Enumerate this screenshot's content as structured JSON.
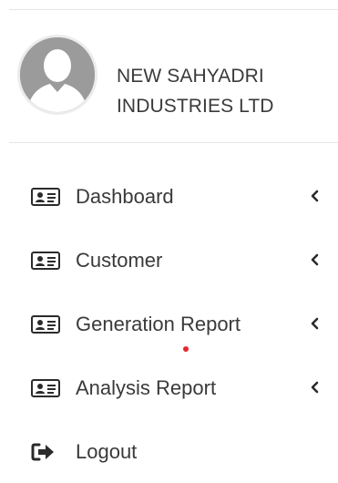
{
  "profile": {
    "name_line1": "NEW SAHYADRI",
    "name_line2": "INDUSTRIES LTD",
    "avatar_icon": "user-silhouette-icon"
  },
  "nav": {
    "items": [
      {
        "label": "Dashboard",
        "icon": "id-card-icon",
        "expandable": true
      },
      {
        "label": "Customer",
        "icon": "id-card-icon",
        "expandable": true
      },
      {
        "label": "Generation Report",
        "icon": "id-card-icon",
        "expandable": true
      },
      {
        "label": "Analysis Report",
        "icon": "id-card-icon",
        "expandable": true
      },
      {
        "label": "Logout",
        "icon": "sign-out-icon",
        "expandable": false
      }
    ]
  },
  "colors": {
    "text": "#3a3a3a",
    "icon": "#2b2b2b",
    "divider": "#e6e6e6",
    "avatar_bg": "#9b9b9b",
    "indicator_dot": "#e8262c"
  }
}
